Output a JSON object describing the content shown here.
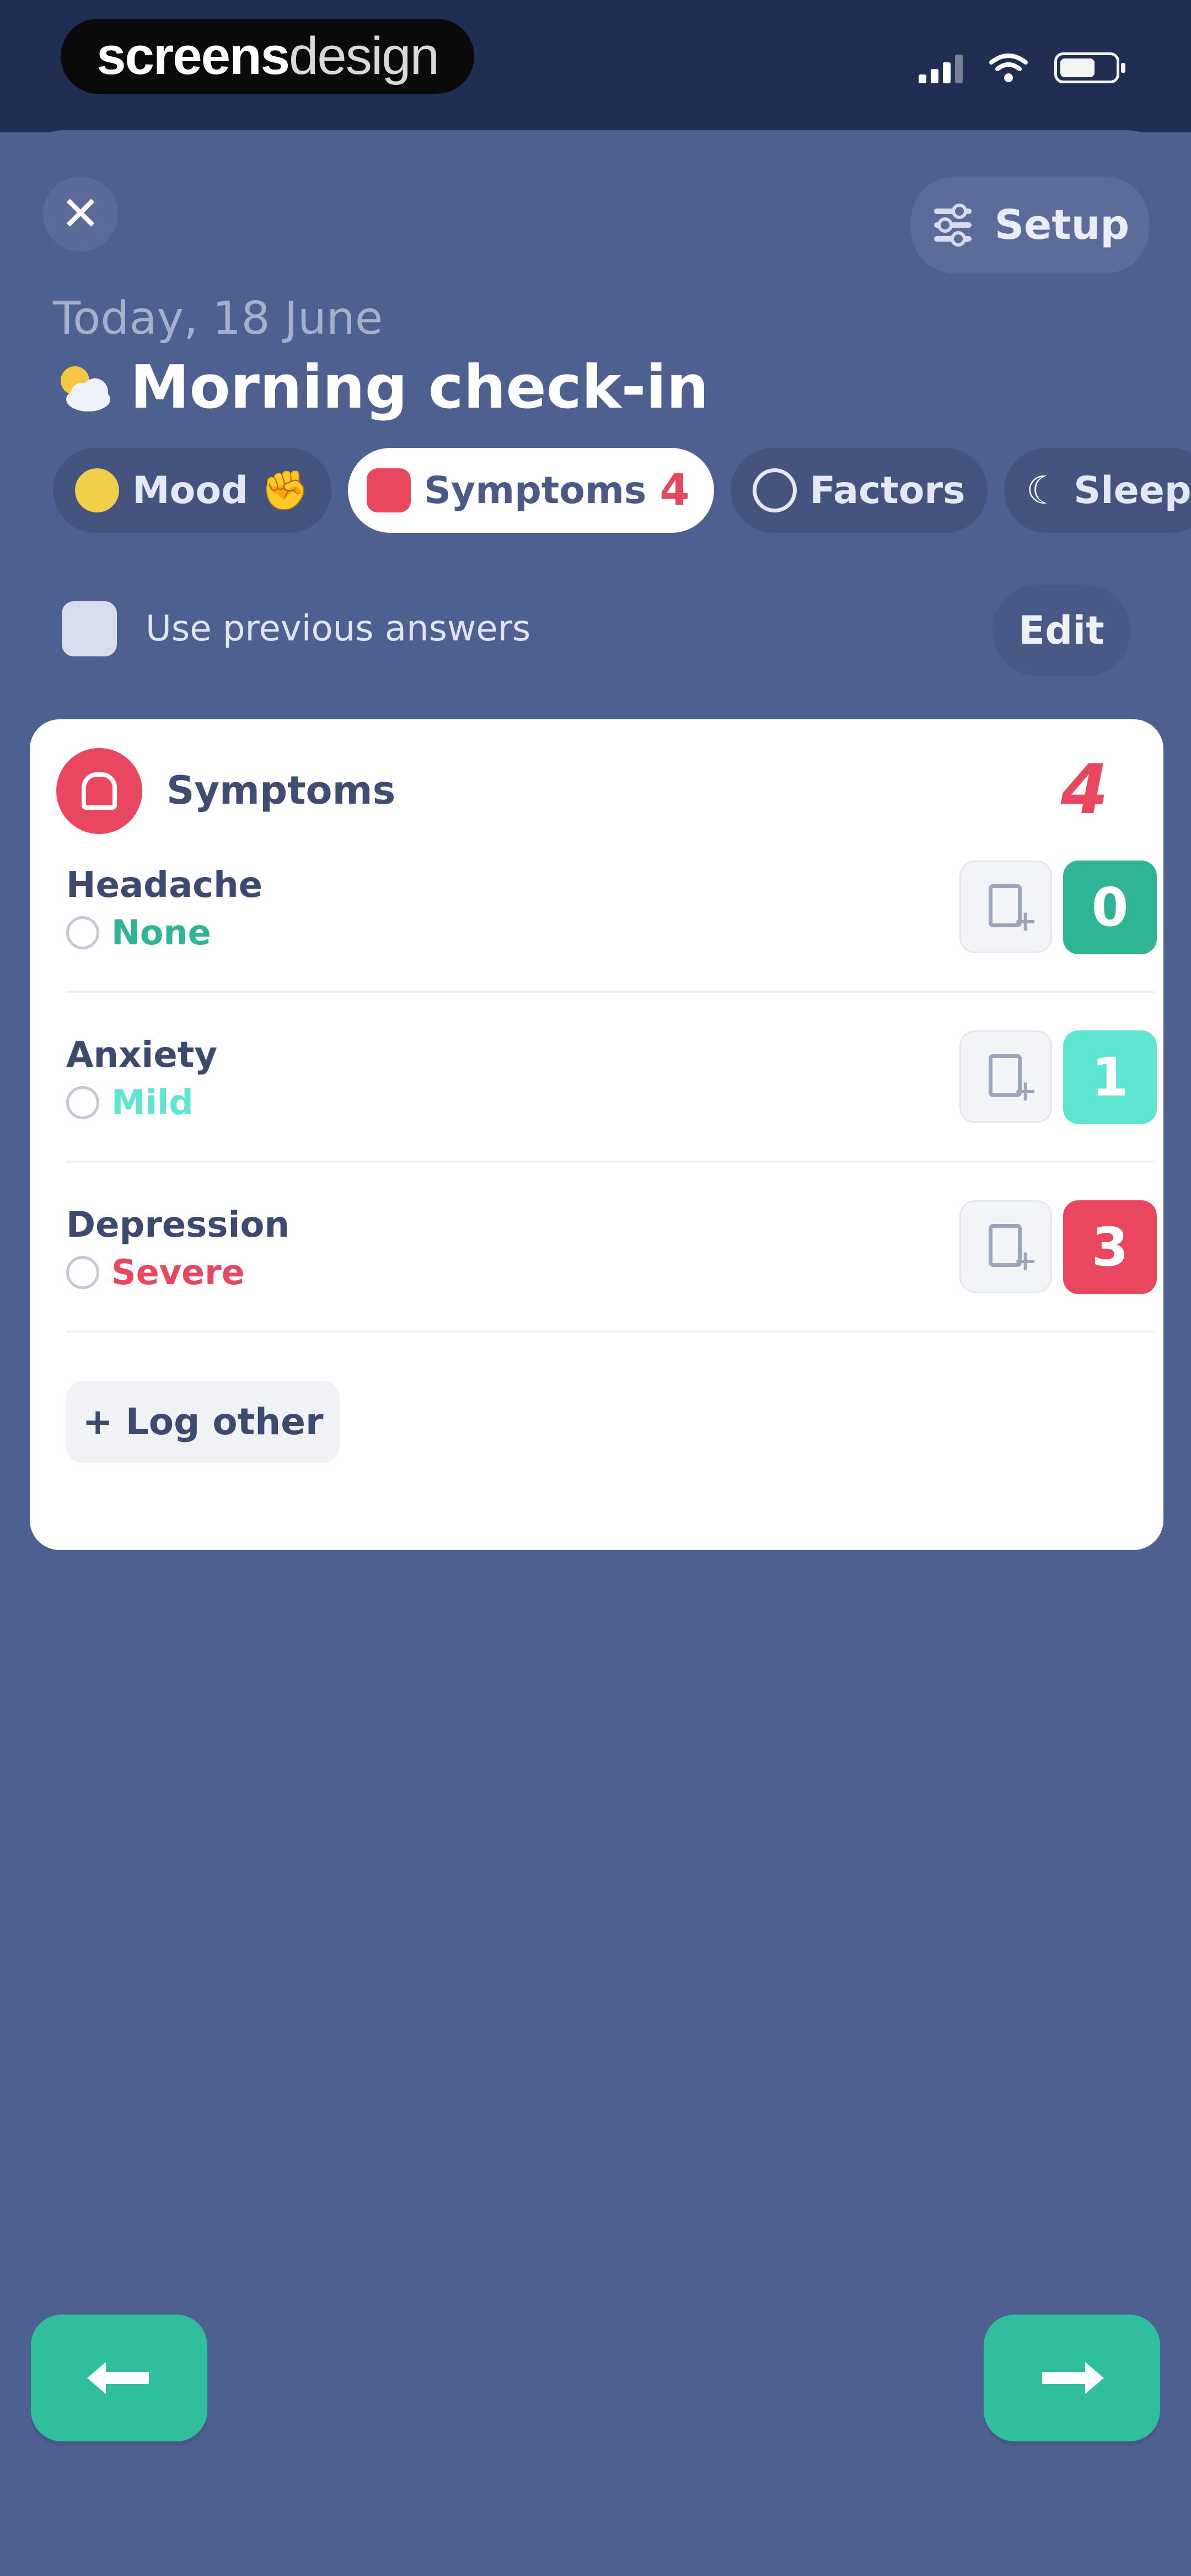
{
  "status_bar": {
    "logo_bold": "screens",
    "logo_light": "design"
  },
  "header": {
    "close_label": "✕",
    "setup_label": "Setup",
    "date": "Today, 18 June",
    "title": "Morning check-in"
  },
  "tabs": [
    {
      "label": "Mood",
      "badge": "",
      "active": false
    },
    {
      "label": "Symptoms",
      "badge": "4",
      "active": true
    },
    {
      "label": "Factors",
      "badge": "",
      "active": false
    },
    {
      "label": "Sleep",
      "badge": "",
      "active": false
    }
  ],
  "previous": {
    "label": "Use previous answers",
    "checked": false,
    "edit_label": "Edit"
  },
  "card": {
    "title": "Symptoms",
    "count": "4",
    "rows": [
      {
        "name": "Headache",
        "level": "None",
        "score": "0",
        "color": "#2fb596"
      },
      {
        "name": "Anxiety",
        "level": "Mild",
        "score": "1",
        "color": "#5ee6d3"
      },
      {
        "name": "Depression",
        "level": "Severe",
        "score": "3",
        "color": "#e8475f"
      }
    ],
    "log_other_label": "+ Log other"
  },
  "navigation": {
    "back_icon": "arrow-left-icon",
    "next_icon": "arrow-right-icon"
  },
  "colors": {
    "background": "#4e6090",
    "accent_green": "#2fbf9d",
    "danger": "#e8475f"
  }
}
